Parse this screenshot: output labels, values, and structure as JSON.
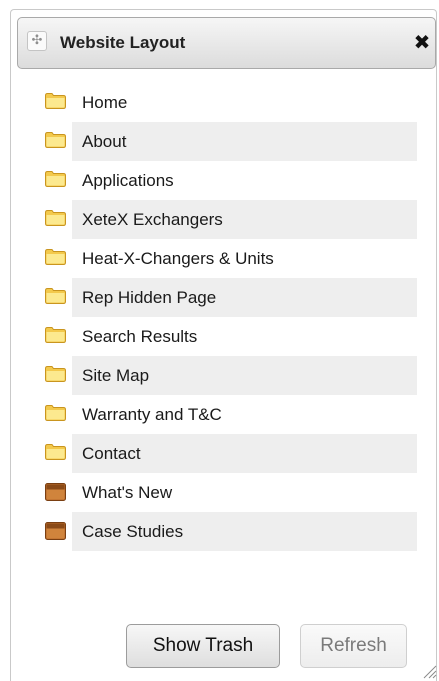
{
  "panel": {
    "title": "Website Layout",
    "move_icon": "move-arrows-icon",
    "close_icon": "close-x-icon",
    "close_glyph": "✖",
    "move_glyph": "✣"
  },
  "pages": [
    {
      "label": "Home",
      "icon": "folder-icon",
      "color": "yellow"
    },
    {
      "label": "About",
      "icon": "folder-icon",
      "color": "yellow"
    },
    {
      "label": "Applications",
      "icon": "folder-icon",
      "color": "yellow"
    },
    {
      "label": "XeteX Exchangers",
      "icon": "folder-icon",
      "color": "yellow"
    },
    {
      "label": "Heat-X-Changers & Units",
      "icon": "folder-icon",
      "color": "yellow"
    },
    {
      "label": "Rep Hidden Page",
      "icon": "folder-icon",
      "color": "yellow"
    },
    {
      "label": "Search Results",
      "icon": "folder-icon",
      "color": "yellow"
    },
    {
      "label": "Site Map",
      "icon": "folder-icon",
      "color": "yellow"
    },
    {
      "label": "Warranty and T&C",
      "icon": "folder-icon",
      "color": "yellow"
    },
    {
      "label": "Contact",
      "icon": "folder-icon",
      "color": "yellow"
    },
    {
      "label": "What's New",
      "icon": "folder-icon",
      "color": "brown"
    },
    {
      "label": "Case Studies",
      "icon": "folder-icon",
      "color": "brown"
    }
  ],
  "buttons": {
    "show_trash": "Show Trash",
    "refresh": "Refresh"
  },
  "colors": {
    "folder_yellow": "#f3c94c",
    "folder_brown": "#b8692a",
    "alt_row": "#eeeeee"
  }
}
